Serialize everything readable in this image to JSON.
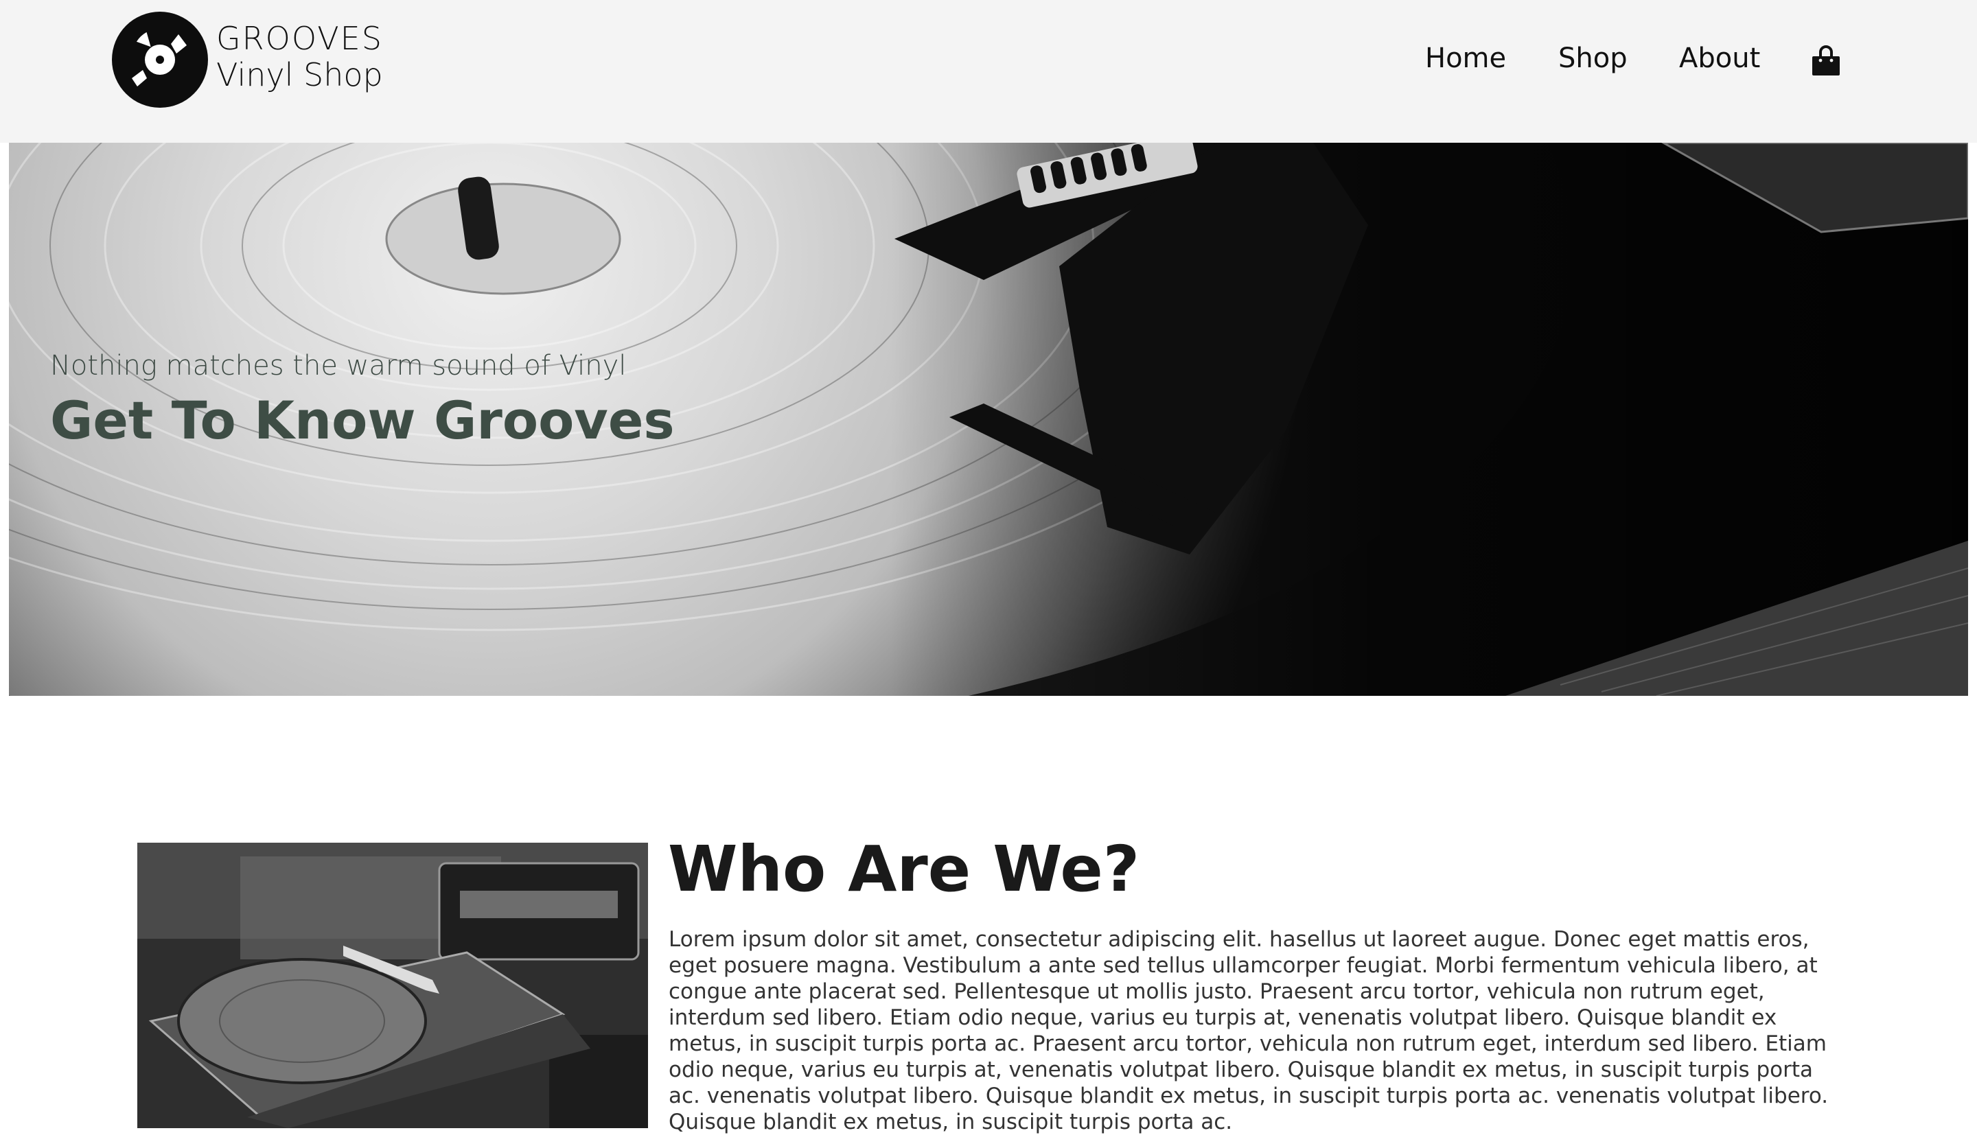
{
  "brand": {
    "line1": "GROOVES",
    "line2": "Vinyl Shop",
    "logo_icon": "vinyl-record-icon"
  },
  "nav": {
    "items": [
      {
        "label": "Home"
      },
      {
        "label": "Shop"
      },
      {
        "label": "About"
      }
    ],
    "cart_icon": "shopping-bag-icon"
  },
  "hero": {
    "subtitle": "Nothing matches the warm sound of Vinyl",
    "title": "Get To Know Grooves"
  },
  "about": {
    "title": "Who Are We?",
    "body": "Lorem ipsum dolor sit amet, consectetur adipiscing elit. hasellus ut laoreet augue. Donec eget mattis eros, eget posuere magna. Vestibulum a ante sed tellus ullamcorper feugiat. Morbi fermentum vehicula libero, at congue ante placerat sed. Pellentesque ut mollis justo. Praesent arcu tortor, vehicula non rutrum eget, interdum sed libero. Etiam odio neque, varius eu turpis at, venenatis volutpat libero. Quisque blandit ex metus, in suscipit turpis porta ac. Praesent arcu tortor, vehicula non rutrum eget, interdum sed libero. Etiam odio neque, varius eu turpis at, venenatis volutpat libero. Quisque blandit ex metus, in suscipit turpis porta ac. venenatis volutpat libero. Quisque blandit ex metus, in suscipit turpis porta ac. venenatis volutpat libero. Quisque blandit ex metus, in suscipit turpis porta ac."
  },
  "colors": {
    "header_bg": "#f4f4f4",
    "hero_text": "#3e4d45",
    "body_text": "#333333"
  }
}
